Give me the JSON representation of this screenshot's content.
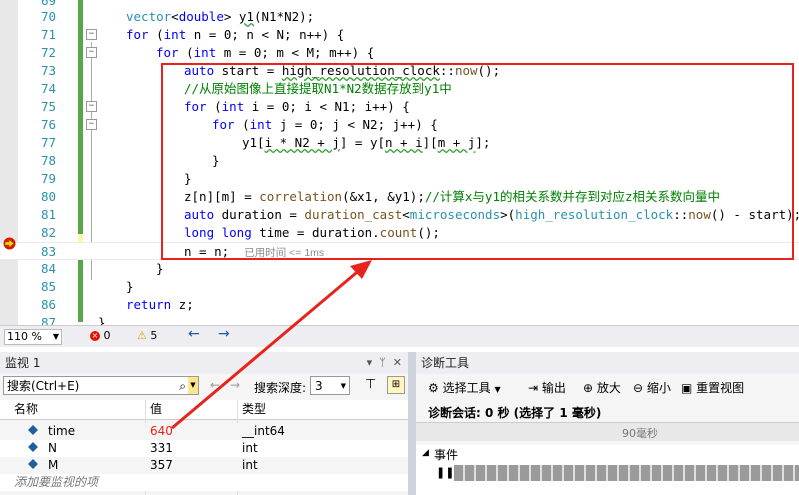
{
  "editor": {
    "line_numbers": [
      "69",
      "70",
      "71",
      "72",
      "73",
      "74",
      "75",
      "76",
      "77",
      "78",
      "79",
      "80",
      "81",
      "82",
      "83",
      "84",
      "85",
      "86",
      "87"
    ],
    "lines": [
      "",
      "vector<double> y1(N1*N2);",
      "for (int n = 0; n < N; n++) {",
      "    for (int m = 0; m < M; m++) {",
      "        auto start = high_resolution_clock::now();",
      "        //从原始图像上直接提取N1*N2数据存放到y1中",
      "        for (int i = 0; i < N1; i++) {",
      "            for (int j = 0; j < N2; j++) {",
      "                y1[i * N2 + j] = y[n + i][m + j];",
      "            }",
      "        }",
      "        z[n][m] = correlation(&x1, &y1);//计算x与y1的相关系数并存到对应z相关系数向量中",
      "        auto duration = duration_cast<microseconds>(high_resolution_clock::now() - start);",
      "        long long time = duration.count();",
      "        n = n;",
      "    }",
      "}",
      "return z;",
      "}"
    ],
    "perf_hint": "已用时间 <= 1ms",
    "zoom": "110 %",
    "errors": "0",
    "warnings": "5"
  },
  "watch": {
    "title": "监视 1",
    "search_placeholder": "搜索(Ctrl+E)",
    "search_depth_label": "搜索深度:",
    "search_depth_value": "3",
    "columns": [
      "名称",
      "值",
      "类型"
    ],
    "rows": [
      {
        "name": "time",
        "value": "640",
        "type": "__int64"
      },
      {
        "name": "N",
        "value": "331",
        "type": "int"
      },
      {
        "name": "M",
        "value": "357",
        "type": "int"
      }
    ],
    "add_item": "添加要监视的项"
  },
  "diag": {
    "title": "诊断工具",
    "select_tools": "选择工具",
    "output": "输出",
    "zoom_in": "放大",
    "zoom_out": "缩小",
    "reset_view": "重置视图",
    "session": "诊断会话: 0 秒 (选择了 1 毫秒)",
    "timeline_label": "90毫秒",
    "events": "事件"
  },
  "colors": {
    "accent_red": "#e8231b",
    "value_changed": "#e8231b"
  }
}
